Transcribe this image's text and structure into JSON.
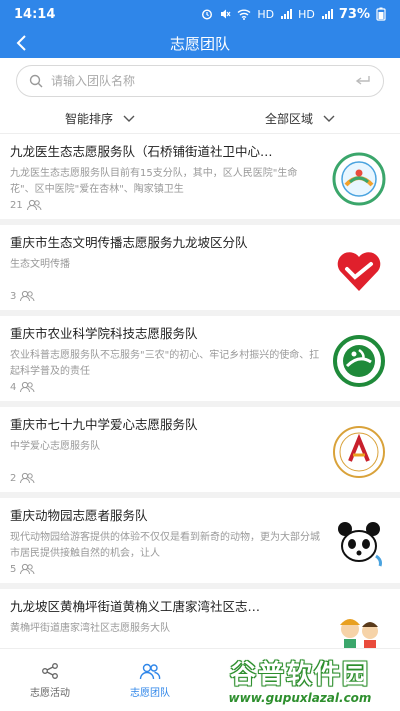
{
  "status": {
    "time": "14:14",
    "net1": "HD",
    "net2": "HD",
    "battery": "73%"
  },
  "header": {
    "title": "志愿团队"
  },
  "search": {
    "placeholder": "请输入团队名称"
  },
  "filters": {
    "sort": "智能排序",
    "region": "全部区域"
  },
  "items": [
    {
      "name": "九龙医生态志愿服务队（石桥铺街道社卫中心…",
      "desc": "九龙医生态志愿服务队目前有15支分队，其中，区人民医院\"生命花\"、区中医院\"爱在杏林\"、陶家镇卫生",
      "count": "21",
      "logo": "clinic-badge"
    },
    {
      "name": "重庆市生态文明传播志愿服务九龙坡区分队",
      "desc": "生态文明传播",
      "count": "3",
      "logo": "heart-hand"
    },
    {
      "name": "重庆市农业科学院科技志愿服务队",
      "desc": "农业科普志愿服务队不忘服务\"三农\"的初心、牢记乡村振兴的使命、扛起科学普及的责任",
      "count": "4",
      "logo": "agri-emblem"
    },
    {
      "name": "重庆市七十九中学爱心志愿服务队",
      "desc": "中学爱心志愿服务队",
      "count": "2",
      "logo": "school-seal"
    },
    {
      "name": "重庆动物园志愿者服务队",
      "desc": "现代动物园给游客提供的体验不仅仅是看到新奇的动物，更为大部分城市居民提供接触自然的机会，让人",
      "count": "5",
      "logo": "panda"
    },
    {
      "name": "九龙坡区黄桷坪街道黄桷义工唐家湾社区志…",
      "desc": "黄桷坪街道唐家湾社区志愿服务大队",
      "count": "",
      "logo": "cartoon-kids"
    }
  ],
  "tabs": [
    {
      "label": "志愿活动"
    },
    {
      "label": "志愿团队"
    }
  ],
  "watermark": {
    "line1": "谷普软件园",
    "line2": "www.gupuxlazal.com"
  },
  "colors": {
    "primary": "#2f86e9",
    "watermark": "#2e8f2e"
  }
}
